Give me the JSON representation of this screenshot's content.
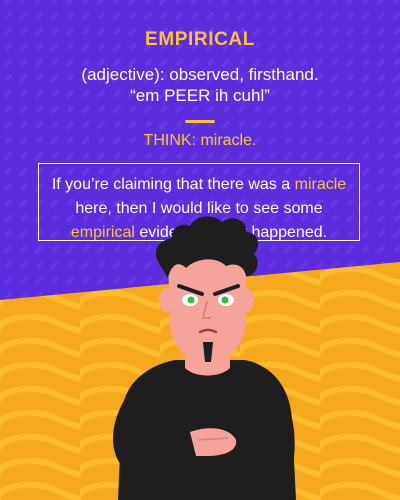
{
  "word": "EMPIRICAL",
  "definition": {
    "line1": "(adjective): observed, firsthand.",
    "line2": "“em PEER ih cuhl”"
  },
  "think": "THINK: miracle.",
  "example": {
    "part1": "If you’re claiming that there was a ",
    "highlight1": "miracle",
    "part2": " here, then I would like to see some ",
    "highlight2": "empirical",
    "part3": " evidence that it happened."
  },
  "colors": {
    "top_background": "#5b2ddc",
    "bottom_background": "#f7a91c",
    "accent": "#ffc233",
    "text": "#ffffff"
  },
  "illustration": {
    "subject": "skeptical cartoon man",
    "icons": [
      "man-illustration-icon"
    ]
  }
}
